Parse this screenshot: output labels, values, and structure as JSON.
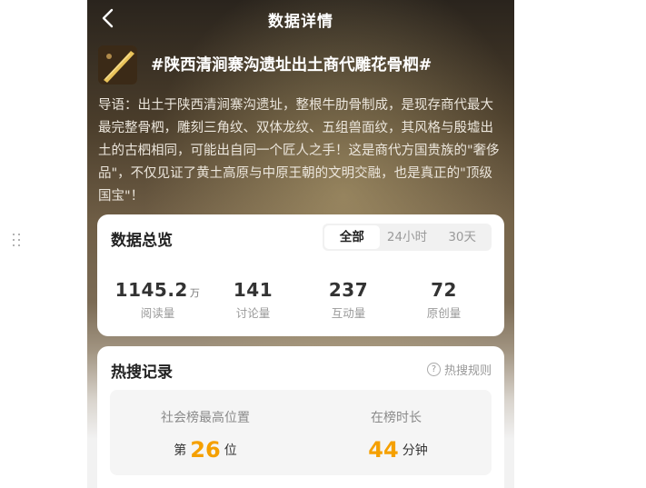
{
  "header": {
    "title": "数据详情",
    "back_icon": "chevron-left-icon"
  },
  "topic": {
    "title": "#陕西清涧寨沟遗址出土商代雕花骨柶#",
    "intro": "导语：出土于陕西清涧寨沟遗址，整根牛肋骨制成，是现存商代最大最完整骨柶，雕刻三角纹、双体龙纹、五组兽面纹，其风格与殷墟出土的古柶相同，可能出自同一个匠人之手！这是商代方国贵族的\"奢侈品\"，不仅见证了黄土高原与中原王朝的文明交融，也是真正的\"顶级国宝\"！"
  },
  "overview": {
    "title": "数据总览",
    "tabs": [
      {
        "label": "全部",
        "active": true
      },
      {
        "label": "24小时",
        "active": false
      },
      {
        "label": "30天",
        "active": false
      }
    ],
    "stats": [
      {
        "value": "1145.2",
        "unit": "万",
        "label": "阅读量"
      },
      {
        "value": "141",
        "unit": "",
        "label": "讨论量"
      },
      {
        "value": "237",
        "unit": "",
        "label": "互动量"
      },
      {
        "value": "72",
        "unit": "",
        "label": "原创量"
      }
    ]
  },
  "hot_search": {
    "title": "热搜记录",
    "rules_label": "热搜规则",
    "rules_icon": "question-circle-icon",
    "rank": {
      "label": "社会榜最高位置",
      "prefix": "第",
      "value": "26",
      "suffix": "位"
    },
    "duration": {
      "label": "在榜时长",
      "value": "44",
      "suffix": "分钟"
    }
  },
  "colors": {
    "accent": "#f5a000",
    "card_bg": "#ffffff",
    "muted_text": "#9a9a9a"
  }
}
